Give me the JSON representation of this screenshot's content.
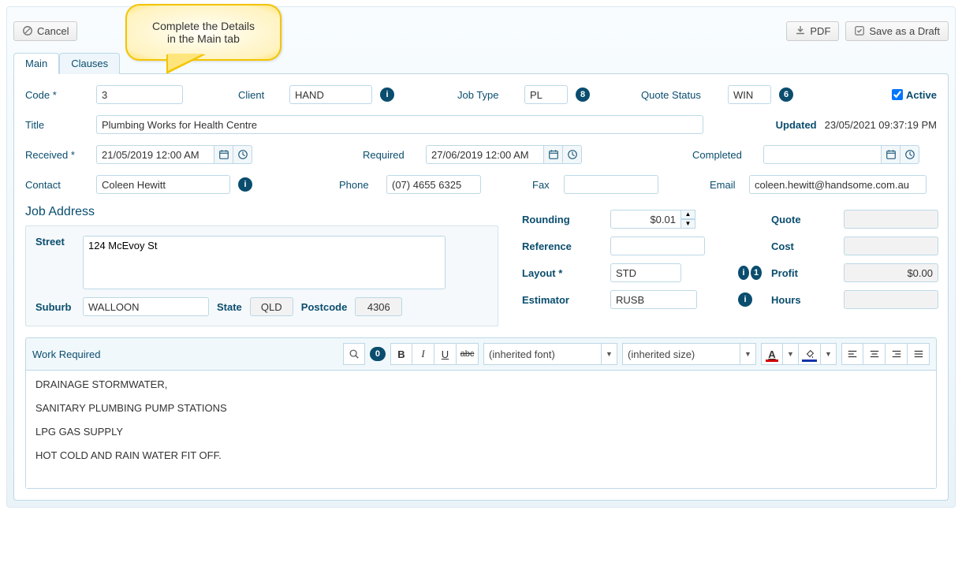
{
  "callout": {
    "line1": "Complete the Details",
    "line2": "in the Main tab"
  },
  "toolbar": {
    "cancel": "Cancel",
    "pdf": "PDF",
    "save_draft": "Save as a Draft"
  },
  "tabs": [
    "Main",
    "Clauses"
  ],
  "labels": {
    "code": "Code",
    "client": "Client",
    "job_type": "Job Type",
    "quote_status": "Quote Status",
    "active": "Active",
    "title": "Title",
    "updated": "Updated",
    "received": "Received",
    "required": "Required",
    "completed": "Completed",
    "contact": "Contact",
    "phone": "Phone",
    "fax": "Fax",
    "email": "Email",
    "job_address": "Job Address",
    "street": "Street",
    "suburb": "Suburb",
    "state": "State",
    "postcode": "Postcode",
    "rounding": "Rounding",
    "reference": "Reference",
    "layout": "Layout",
    "estimator": "Estimator",
    "quote": "Quote",
    "cost": "Cost",
    "profit": "Profit",
    "hours": "Hours",
    "work_required": "Work Required"
  },
  "badges": {
    "job_type": "8",
    "quote_status": "6",
    "layout": "1",
    "editor_count": "0"
  },
  "fields": {
    "code": "3",
    "client": "HAND",
    "job_type": "PL",
    "quote_status": "WIN",
    "active": true,
    "title": "Plumbing Works for Health Centre",
    "updated": "23/05/2021 09:37:19 PM",
    "received": "21/05/2019 12:00 AM",
    "required": "27/06/2019 12:00 AM",
    "completed": "",
    "contact": "Coleen Hewitt",
    "phone": "(07) 4655 6325",
    "fax": "",
    "email": "coleen.hewitt@handsome.com.au",
    "street": "124 McEvoy St",
    "suburb": "WALLOON",
    "state": "QLD",
    "postcode": "4306",
    "rounding": "$0.01",
    "reference": "",
    "layout": "STD",
    "estimator": "RUSB",
    "quote": "",
    "cost": "",
    "profit": "$0.00",
    "hours": "",
    "work_required": "DRAINAGE STORMWATER,\n\nSANITARY PLUMBING PUMP STATIONS\n\nLPG GAS SUPPLY\n\nHOT COLD AND RAIN WATER FIT OFF."
  },
  "editor": {
    "font": "(inherited font)",
    "size": "(inherited size)"
  }
}
